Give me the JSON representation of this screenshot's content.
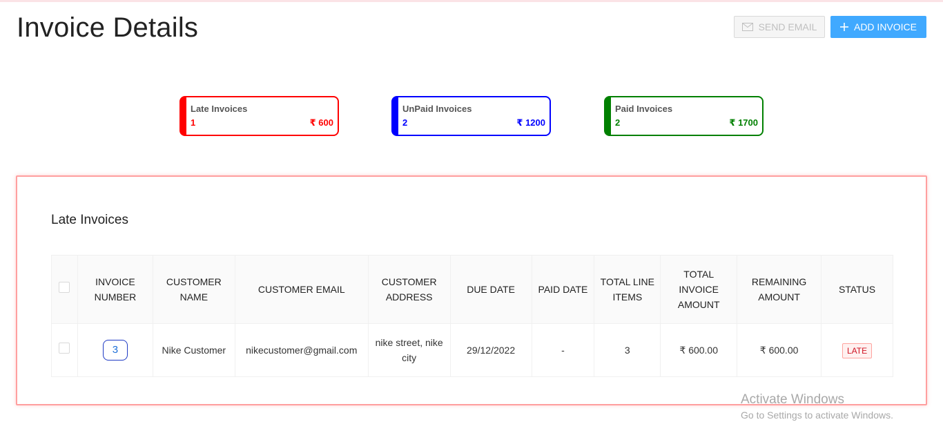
{
  "page": {
    "title": "Invoice Details"
  },
  "toolbar": {
    "send_email_label": "SEND EMAIL",
    "add_invoice_label": "ADD INVOICE"
  },
  "summary_cards": [
    {
      "title": "Late Invoices",
      "count": "1",
      "amount": "₹ 600",
      "color": "#ff0000"
    },
    {
      "title": "UnPaid Invoices",
      "count": "2",
      "amount": "₹ 1200",
      "color": "#0000ff"
    },
    {
      "title": "Paid Invoices",
      "count": "2",
      "amount": "₹ 1700",
      "color": "#008000"
    }
  ],
  "panel": {
    "title": "Late Invoices",
    "border_color": "#ff9f9f"
  },
  "table": {
    "headers": [
      "INVOICE NUMBER",
      "CUSTOMER NAME",
      "CUSTOMER EMAIL",
      "CUSTOMER ADDRESS",
      "DUE DATE",
      "PAID DATE",
      "TOTAL LINE ITEMS",
      "TOTAL INVOICE AMOUNT",
      "REMAINING AMOUNT",
      "STATUS"
    ],
    "rows": [
      {
        "invoice_number": "3",
        "customer_name": "Nike Customer",
        "customer_email": "nikecustomer@gmail.com",
        "customer_address": "nike street, nike city",
        "due_date": "29/12/2022",
        "paid_date": "-",
        "total_line_items": "3",
        "total_invoice_amount": "₹ 600.00",
        "remaining_amount": "₹ 600.00",
        "status": "LATE"
      }
    ]
  },
  "watermark": {
    "line1": "Activate Windows",
    "line2": "Go to Settings to activate Windows."
  },
  "icons": {
    "send_email": "mail-icon",
    "add_invoice": "plus-icon"
  },
  "colors": {
    "accent": "#40a9ff",
    "late_tag": "#cf1322"
  }
}
